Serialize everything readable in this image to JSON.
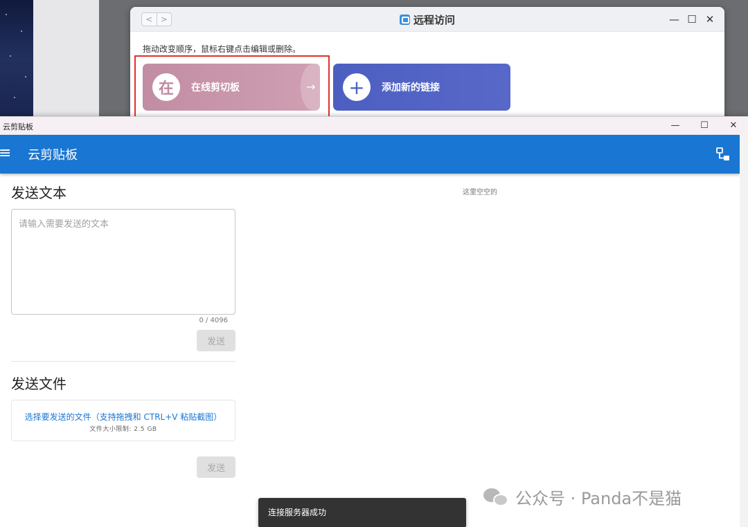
{
  "remote_window": {
    "title": "远程访问",
    "nav_back": "<",
    "nav_forward": ">",
    "minimize": "—",
    "maximize": "☐",
    "close": "✕",
    "hint": "拖动改变顺序，鼠标右键点击编辑或删除。",
    "cards": [
      {
        "icon_text": "在",
        "label": "在线剪切板",
        "arrow": "→"
      },
      {
        "icon_text": "+",
        "label": "添加新的链接"
      }
    ]
  },
  "clipboard_window": {
    "window_title": "云剪贴板",
    "minimize": "—",
    "maximize": "☐",
    "close": "✕",
    "app_bar": {
      "menu_icon": "≡",
      "title": "云剪贴板"
    },
    "send_text": {
      "heading": "发送文本",
      "placeholder": "请输入需要发送的文本",
      "value": "",
      "counter": "0 / 4096",
      "send_label": "发送"
    },
    "send_file": {
      "heading": "发送文件",
      "prompt": "选择要发送的文件（支持拖拽和 CTRL+V 粘贴截图）",
      "limit": "文件大小限制: 2.5 GB",
      "send_label": "发送"
    },
    "empty_message": "这里空空的",
    "snackbar": "连接服务器成功"
  },
  "watermark": {
    "text": "公众号 · Panda不是猫"
  },
  "colors": {
    "app_bar": "#1976d2",
    "card_online": "#c28da3",
    "card_add": "#4c5fc1",
    "highlight": "#e0302c",
    "snackbar": "#333333"
  },
  "icons": {
    "menu": "hamburger-menu-icon",
    "network": "network-devices-icon",
    "app": "remote-access-app-icon",
    "watermark": "wechat-icon"
  }
}
